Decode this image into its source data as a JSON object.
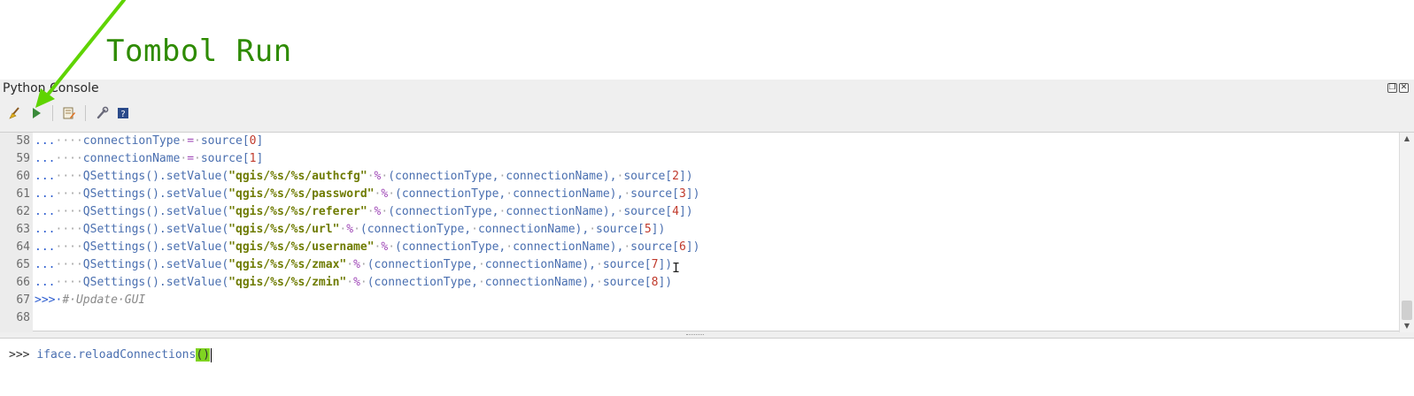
{
  "annotation": {
    "title": "Tombol Run",
    "arrow_color": "#5fd400"
  },
  "panel": {
    "title": "Python Console",
    "controls": [
      "float-icon",
      "close-icon"
    ]
  },
  "toolbar": {
    "buttons": [
      {
        "name": "clear-console-button",
        "icon": "broom-icon"
      },
      {
        "name": "run-command-button",
        "icon": "play-icon"
      },
      {
        "name": "show-editor-button",
        "icon": "edit-script-icon"
      },
      {
        "name": "options-button",
        "icon": "wrench-icon"
      },
      {
        "name": "help-button",
        "icon": "help-book-icon"
      }
    ]
  },
  "editor": {
    "lines": [
      {
        "num": "58",
        "code": "...····connectionType·=·source[0]"
      },
      {
        "num": "59",
        "code": "...····connectionName·=·source[1]"
      },
      {
        "num": "60",
        "code": "...····QSettings().setValue(\"qgis/%s/%s/authcfg\"·%·(connectionType,·connectionName),·source[2])"
      },
      {
        "num": "61",
        "code": "...····QSettings().setValue(\"qgis/%s/%s/password\"·%·(connectionType,·connectionName),·source[3])"
      },
      {
        "num": "62",
        "code": "...····QSettings().setValue(\"qgis/%s/%s/referer\"·%·(connectionType,·connectionName),·source[4])"
      },
      {
        "num": "63",
        "code": "...····QSettings().setValue(\"qgis/%s/%s/url\"·%·(connectionType,·connectionName),·source[5])"
      },
      {
        "num": "64",
        "code": "...····QSettings().setValue(\"qgis/%s/%s/username\"·%·(connectionType,·connectionName),·source[6])"
      },
      {
        "num": "65",
        "code": "...····QSettings().setValue(\"qgis/%s/%s/zmax\"·%·(connectionType,·connectionName),·source[7])"
      },
      {
        "num": "66",
        "code": "...····QSettings().setValue(\"qgis/%s/%s/zmin\"·%·(connectionType,·connectionName),·source[8])"
      },
      {
        "num": "67",
        "code": ">>>·#·Update·GUI"
      },
      {
        "num": "68",
        "code": ""
      }
    ]
  },
  "input": {
    "prompt": ">>> ",
    "code": "iface.reloadConnections",
    "paren": "()"
  },
  "colors": {
    "string": "#6e7b00",
    "number": "#c0392b",
    "identifier": "#4a6fb0",
    "annotation": "#2e8b00"
  }
}
